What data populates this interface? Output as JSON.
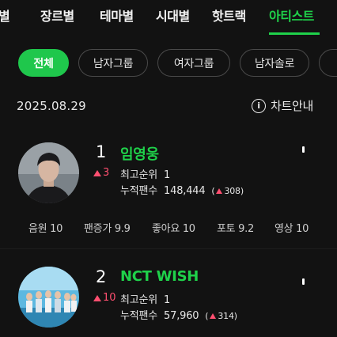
{
  "tabs": [
    {
      "label": "별",
      "active": false
    },
    {
      "label": "장르별",
      "active": false
    },
    {
      "label": "테마별",
      "active": false
    },
    {
      "label": "시대별",
      "active": false
    },
    {
      "label": "핫트랙",
      "active": false
    },
    {
      "label": "아티스트",
      "active": true
    }
  ],
  "chips": [
    {
      "label": "전체",
      "active": true
    },
    {
      "label": "남자그룹",
      "active": false
    },
    {
      "label": "여자그룹",
      "active": false
    },
    {
      "label": "남자솔로",
      "active": false
    },
    {
      "label": "",
      "active": false
    }
  ],
  "chart_header": {
    "date": "2025.08.29",
    "guide_label": "차트안내",
    "guide_icon": "info-icon"
  },
  "entries": [
    {
      "rank": "1",
      "name": "임영웅",
      "rank_change": "3",
      "best_rank_label": "최고순위",
      "best_rank": "1",
      "fans_label": "누적팬수",
      "fans": "148,444",
      "fans_delta": "308",
      "scores": [
        {
          "label": "음원",
          "value": "10"
        },
        {
          "label": "팬증가",
          "value": "9.9"
        },
        {
          "label": "좋아요",
          "value": "10"
        },
        {
          "label": "포토",
          "value": "9.2"
        },
        {
          "label": "영상",
          "value": "10"
        }
      ]
    },
    {
      "rank": "2",
      "name": "NCT WISH",
      "rank_change": "10",
      "best_rank_label": "최고순위",
      "best_rank": "1",
      "fans_label": "누적팬수",
      "fans": "57,960",
      "fans_delta": "314"
    }
  ],
  "colors": {
    "accent": "#1fd14a",
    "up": "#ff4f70",
    "background": "#121212"
  }
}
